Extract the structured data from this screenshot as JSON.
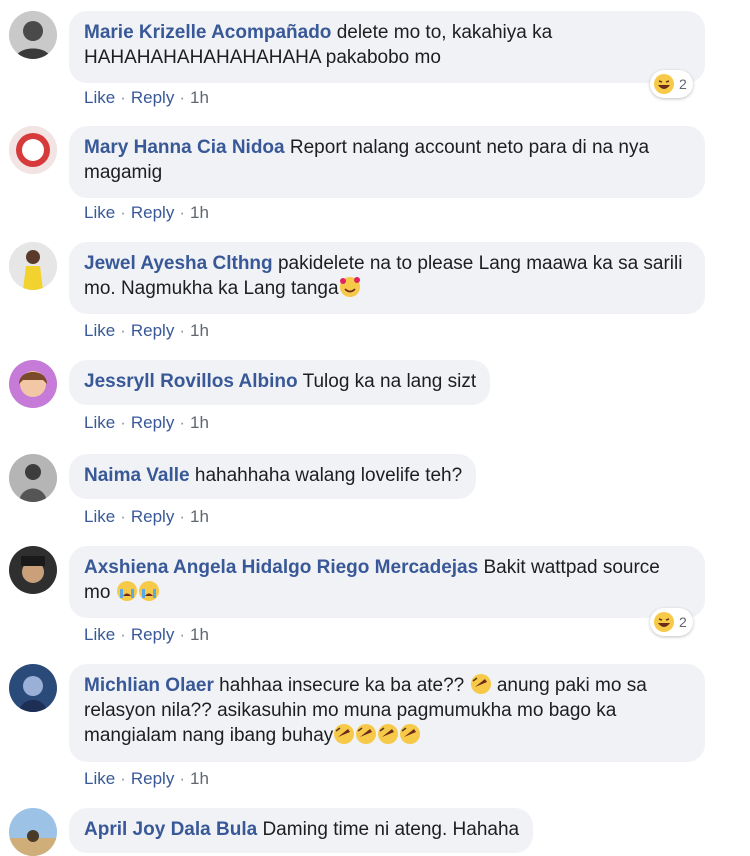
{
  "actions": {
    "like": "Like",
    "reply": "Reply",
    "dot": "·"
  },
  "colors": {
    "author": "#385898",
    "bubble": "#f0f2f5",
    "meta": "#606770"
  },
  "comments": [
    {
      "author": "Marie Krizelle Acompañado",
      "text": "delete mo to, kakahiya ka HAHAHAHAHAHAHAHAHA pakabobo mo",
      "time": "1h",
      "reaction_count": "2",
      "reaction_icon": "haha-emoji-icon"
    },
    {
      "author": "Mary Hanna Cia Nidoa",
      "text": "Report nalang account neto para di na nya magamig",
      "time": "1h"
    },
    {
      "author": "Jewel Ayesha Clthng",
      "text": "pakidelete na to please Lang maawa ka sa sarili mo. Nagmukha ka Lang tanga",
      "time": "1h"
    },
    {
      "author": "Jessryll Rovillos Albino",
      "text": "Tulog ka na lang sizt",
      "time": "1h"
    },
    {
      "author": "Naima Valle",
      "text": "hahahhaha walang lovelife teh?",
      "time": "1h"
    },
    {
      "author": "Axshiena Angela Hidalgo Riego Mercadejas",
      "text": "Bakit wattpad source mo",
      "time": "1h",
      "reaction_count": "2",
      "reaction_icon": "haha-emoji-icon"
    },
    {
      "author": "Michlian Olaer",
      "text_a": "hahhaa insecure ka ba ate??",
      "text_b": "anung paki mo sa relasyon nila?? asikasuhin mo muna pagmumukha mo bago ka mangialam nang ibang buhay",
      "time": "1h"
    },
    {
      "author": "April Joy Dala Bula",
      "text": "Daming time ni ateng. Hahaha"
    }
  ]
}
